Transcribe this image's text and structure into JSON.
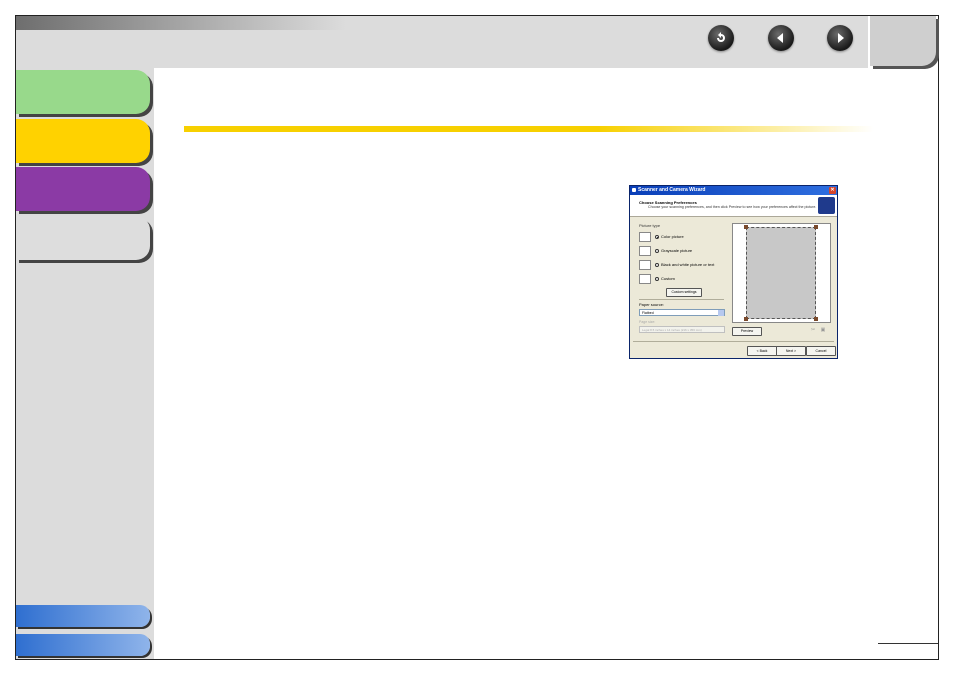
{
  "nav": {
    "back_icon": "return-arrow-icon",
    "prev_icon": "left-arrow-icon",
    "next_icon": "right-arrow-icon"
  },
  "dialog": {
    "title": "Scanner and Camera Wizard",
    "close_symbol": "✕",
    "heading": "Choose Scanning Preferences",
    "subheading": "Choose your scanning preferences, and then click Preview to see how your preferences affect the picture.",
    "picture_type_label": "Picture type",
    "options": [
      {
        "label": "Color picture",
        "selected": true
      },
      {
        "label": "Grayscale picture",
        "selected": false
      },
      {
        "label": "Black and white picture or text",
        "selected": false
      },
      {
        "label": "Custom",
        "selected": false
      }
    ],
    "custom_settings_label": "Custom settings",
    "paper_source_label": "Paper source:",
    "paper_source_value": "Flatbed",
    "page_size_label": "Page size:",
    "page_size_value": "Legal 8.5 inches x 14 inches (216 x 356 mm)",
    "preview_label": "Preview",
    "back_label": "< Back",
    "next_label": "Next >",
    "cancel_label": "Cancel"
  },
  "colors": {
    "tab_green": "#98d98b",
    "tab_yellow": "#ffd200",
    "tab_purple": "#8b3aa5",
    "tab_gray": "#dddddd",
    "accent_line": "#f7d000",
    "blue_tab": "#2f6fd0"
  }
}
